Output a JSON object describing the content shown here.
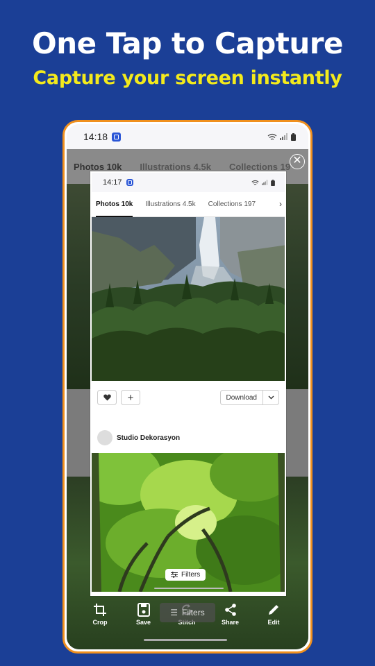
{
  "promo": {
    "headline": "One Tap to Capture",
    "subheadline": "Capture your screen instantly"
  },
  "colors": {
    "background": "#1b3f96",
    "headline": "#ffffff",
    "subheadline": "#f3ea1c",
    "frame": "#f0901e"
  },
  "device": {
    "status_time": "14:18",
    "status_icons": [
      "wifi-icon",
      "signal-icon",
      "battery-icon"
    ]
  },
  "background_page": {
    "tabs": [
      "Photos 10k",
      "Illustrations 4.5k",
      "Collections 19"
    ]
  },
  "capture": {
    "status_time": "14:17",
    "tabs": [
      "Photos 10k",
      "Illustrations 4.5k",
      "Collections 197"
    ],
    "actions": {
      "download_label": "Download"
    },
    "author_name": "Studio Dekorasyon",
    "filters_label": "Filters"
  },
  "toolbar": {
    "crop_label": "Crop",
    "save_label": "Save",
    "stitch_label": "Stitch",
    "share_label": "Share",
    "edit_label": "Edit",
    "filters_overlay_label": "Filters"
  }
}
